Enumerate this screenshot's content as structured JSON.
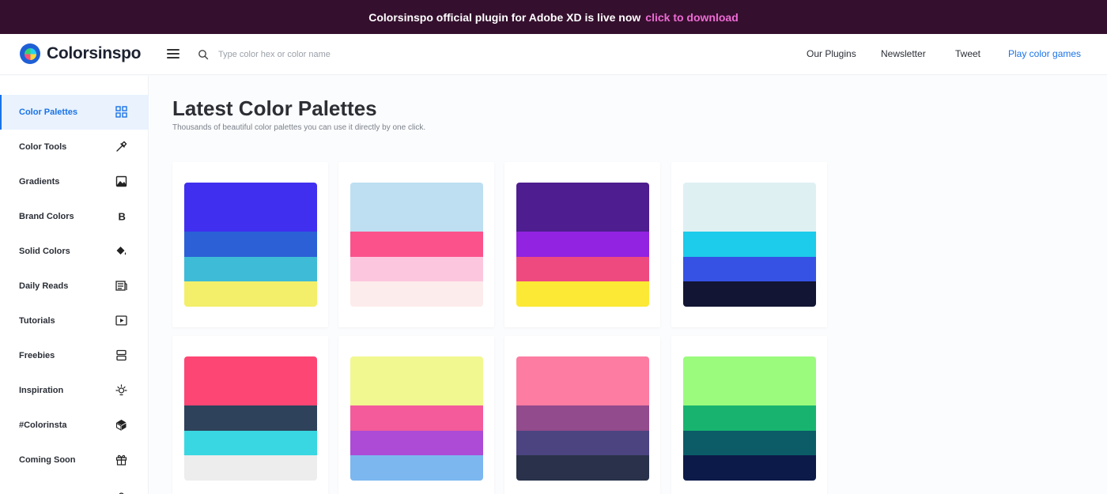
{
  "banner": {
    "text": "Colorsinspo official plugin for Adobe XD is live now",
    "link": "click to download"
  },
  "header": {
    "logo_text": "Colorsinspo",
    "search_placeholder": "Type color hex or color name",
    "nav": [
      "Our Plugins",
      "Newsletter",
      "Tweet",
      "Play color games"
    ]
  },
  "sidebar": {
    "items": [
      {
        "label": "Color Palettes",
        "icon": "grid-icon"
      },
      {
        "label": "Color Tools",
        "icon": "eyedropper-icon"
      },
      {
        "label": "Gradients",
        "icon": "image-icon"
      },
      {
        "label": "Brand Colors",
        "icon": "bold-b-icon"
      },
      {
        "label": "Solid Colors",
        "icon": "paint-bucket-icon"
      },
      {
        "label": "Daily Reads",
        "icon": "newspaper-icon"
      },
      {
        "label": "Tutorials",
        "icon": "play-icon"
      },
      {
        "label": "Freebies",
        "icon": "stack-icon"
      },
      {
        "label": "Inspiration",
        "icon": "bulb-icon"
      },
      {
        "label": "#Colorinsta",
        "icon": "cube-icon"
      },
      {
        "label": "Coming Soon",
        "icon": "gift-icon"
      }
    ]
  },
  "main": {
    "title": "Latest Color Palettes",
    "subtitle": "Thousands of beautiful color palettes you can use it directly by one click."
  },
  "palettes": [
    [
      "#402fef",
      "#2b60d6",
      "#3ebbd6",
      "#f3ef6a"
    ],
    [
      "#bddff1",
      "#fb528c",
      "#fcc7de",
      "#fdecec"
    ],
    [
      "#4e1d8f",
      "#9223e0",
      "#ef4a80",
      "#fbe935"
    ],
    [
      "#dff0f3",
      "#1dcbea",
      "#3652e5",
      "#121533"
    ],
    [
      "#fd4674",
      "#2e425b",
      "#38d7e1",
      "#ededed"
    ],
    [
      "#f1f890",
      "#f35b9b",
      "#ad4bd6",
      "#7cb7ef"
    ],
    [
      "#fc7ca2",
      "#924b8c",
      "#4b4480",
      "#29324a"
    ],
    [
      "#9bfb7d",
      "#18b46f",
      "#0b5c67",
      "#0c1a49"
    ]
  ],
  "colors": {
    "accent": "#1a73e8",
    "banner_bg": "#35102e",
    "banner_link": "#ee6bd5",
    "active_bg": "#e9f2fd"
  }
}
